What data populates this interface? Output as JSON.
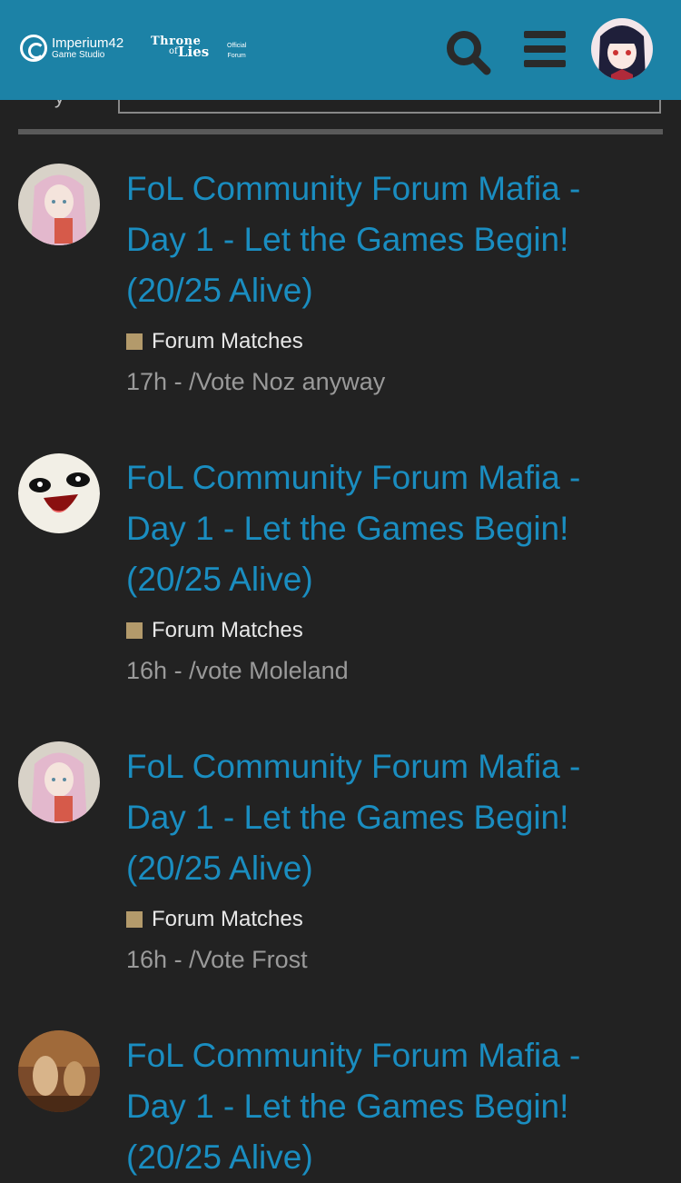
{
  "header": {
    "logo_main": "Imperium42",
    "logo_sub": "Game Studio",
    "logo_throne_1": "Throne",
    "logo_throne_2": "of",
    "logo_throne_3": "Lies",
    "official_1": "Official",
    "official_2": "Forum",
    "search_icon": "search-icon",
    "menu_icon": "hamburger-menu-icon",
    "avatar": "user-avatar"
  },
  "partial_label": "y",
  "colors": {
    "header_bg": "#1c82a6",
    "page_bg": "#222222",
    "link": "#1a8dc0",
    "category_swatch": "#b39a6b"
  },
  "topics": [
    {
      "title": "FoL Community Forum Mafia - Day 1 - Let the Games Begin! (20/25 Alive)",
      "category": "Forum Matches",
      "age": "17h",
      "separator": "-",
      "excerpt": "/Vote Noz anyway",
      "avatar": "pink-hair-avatar"
    },
    {
      "title": "FoL Community Forum Mafia - Day 1 - Let the Games Begin! (20/25 Alive)",
      "category": "Forum Matches",
      "age": "16h",
      "separator": "-",
      "excerpt": "/vote Moleland",
      "avatar": "laughing-face-avatar"
    },
    {
      "title": "FoL Community Forum Mafia - Day 1 - Let the Games Begin! (20/25 Alive)",
      "category": "Forum Matches",
      "age": "16h",
      "separator": "-",
      "excerpt": "/Vote Frost",
      "avatar": "pink-hair-avatar"
    },
    {
      "title": "FoL Community Forum Mafia - Day 1 - Let the Games Begin! (20/25 Alive)",
      "category": "Forum Matches",
      "age": "",
      "separator": "",
      "excerpt": "",
      "avatar": "painting-avatar"
    }
  ]
}
